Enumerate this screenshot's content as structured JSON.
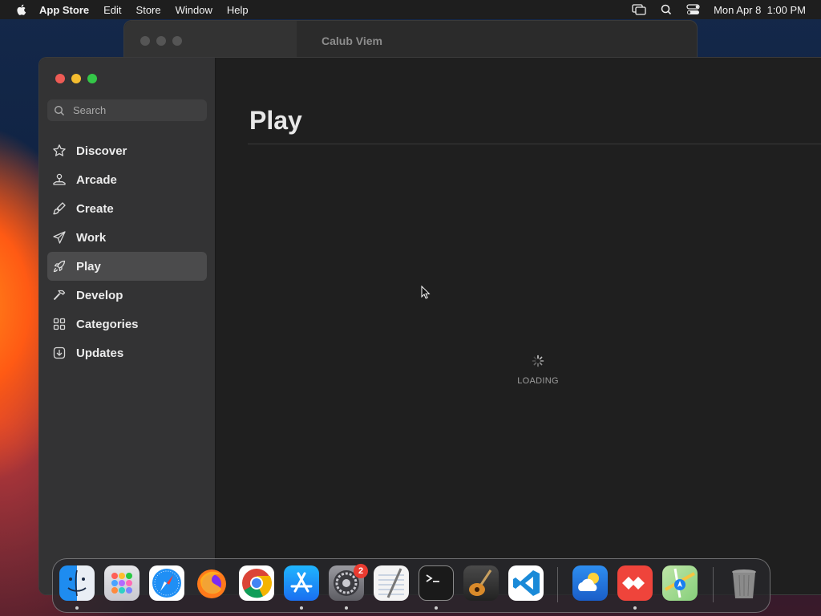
{
  "menubar": {
    "app_name": "App Store",
    "items": [
      "Edit",
      "Store",
      "Window",
      "Help"
    ],
    "clock": "Mon Apr 8  1:00 PM"
  },
  "background_window": {
    "title": "Calub Viem"
  },
  "sidebar": {
    "search_placeholder": "Search",
    "items": [
      {
        "label": "Discover",
        "icon": "star-icon"
      },
      {
        "label": "Arcade",
        "icon": "joystick-icon"
      },
      {
        "label": "Create",
        "icon": "brush-icon"
      },
      {
        "label": "Work",
        "icon": "paperplane-icon"
      },
      {
        "label": "Play",
        "icon": "rocket-icon",
        "selected": true
      },
      {
        "label": "Develop",
        "icon": "hammer-icon"
      },
      {
        "label": "Categories",
        "icon": "grid-icon"
      },
      {
        "label": "Updates",
        "icon": "download-icon"
      }
    ]
  },
  "main": {
    "page_title": "Play",
    "loading_text": "LOADING"
  },
  "dock": {
    "apps": [
      "Finder",
      "Launchpad",
      "Safari",
      "Firefox",
      "Chrome",
      "App Store",
      "System Settings",
      "TextEdit",
      "Terminal",
      "GarageBand",
      "VS Code",
      "Weather",
      "AnyDesk",
      "Maps",
      "Trash"
    ],
    "system_settings_badge": "2"
  },
  "colors": {
    "selected_item_bg": "#4b4b4c",
    "window_bg": "#1f1f1f",
    "sidebar_bg": "#333334"
  }
}
